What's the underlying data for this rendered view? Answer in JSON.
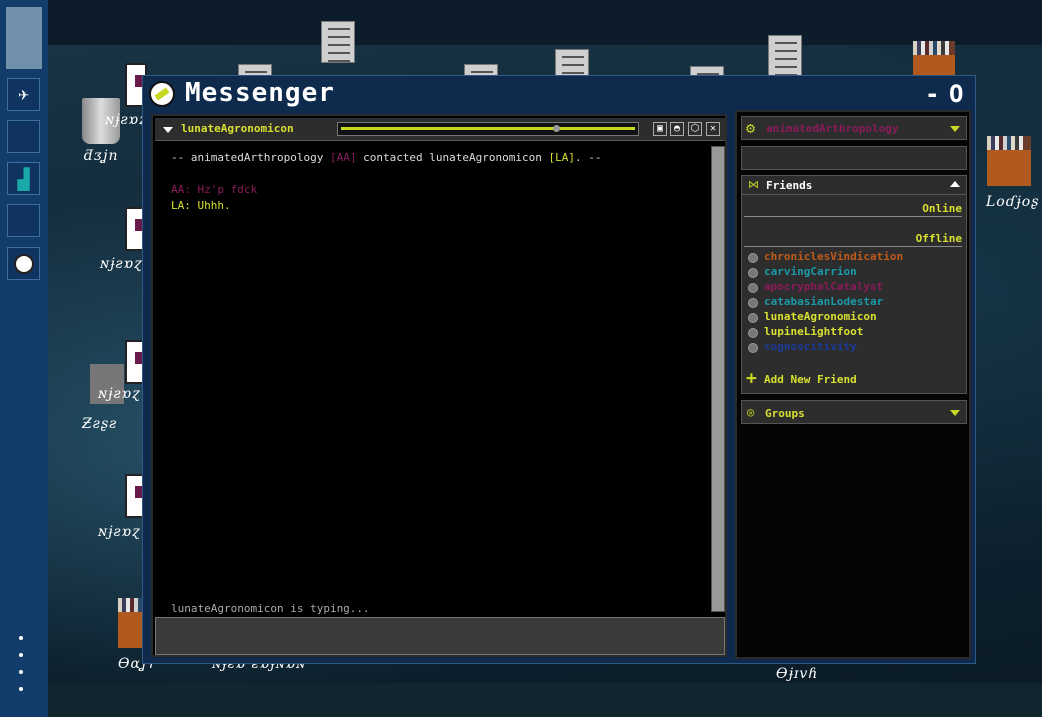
{
  "taskbar": {
    "icons": [
      "satellite-icon",
      "empty-slot",
      "city-icon",
      "empty-slot",
      "messenger-icon"
    ]
  },
  "desktop": {
    "labels": {
      "trash": "ƌᴣʝn",
      "file1": "ɴɉƨɒɀ",
      "file2": "ɴɉƨɒɀ",
      "file3": "ɴɉƨɒɀ",
      "file4": "ɴɉƨɒɀ",
      "zsos": "Ƶƨʂƨ",
      "bojs": "Ɵɑʝɿ",
      "long": "ɴɉƨɒ·ƨɒɉɴɒɴ",
      "lodjos": "Loɗɉoʂ",
      "ojivh": "Ɵɉɪvɦ"
    }
  },
  "window": {
    "title": "Messenger",
    "minimize": "-",
    "close": "O"
  },
  "chat": {
    "contact": "lunateAgronomicon",
    "slider_value": 0.74,
    "system_line_prefix": "-- animatedArthropology ",
    "system_tag1": "[AA]",
    "system_mid": " contacted lunateAgronomicon ",
    "system_tag2": "[LA]",
    "system_suffix": ". --",
    "messages": [
      {
        "speaker": "AA",
        "text": "AA: Hz'p fdck"
      },
      {
        "speaker": "LA",
        "text": "LA: Uhhh."
      }
    ],
    "typing_status": "lunateAgronomicon is typing...",
    "input_value": ""
  },
  "sidebar": {
    "username": "animatedArthropology",
    "mood_value": "",
    "friends_header": "Friends",
    "online_label": "Online",
    "offline_label": "Offline",
    "friends": [
      {
        "name": "chroniclesVindication",
        "color": "#c05a1a"
      },
      {
        "name": "carvingCarrion",
        "color": "#1a9aa8"
      },
      {
        "name": "apocryphalCatalyst",
        "color": "#8a1a5a"
      },
      {
        "name": "catabasianLodestar",
        "color": "#1a9aa8"
      },
      {
        "name": "lunateAgronomicon",
        "color": "#d8e030"
      },
      {
        "name": "lupineLightfoot",
        "color": "#d8e030"
      },
      {
        "name": "cognoscitivity",
        "color": "#1a3a9a"
      }
    ],
    "add_friend": "Add New Friend",
    "groups": "Groups"
  },
  "colors": {
    "accent": "#d8e030",
    "window_bg": "#0e2b4e",
    "taskbar": "#123c6a"
  }
}
